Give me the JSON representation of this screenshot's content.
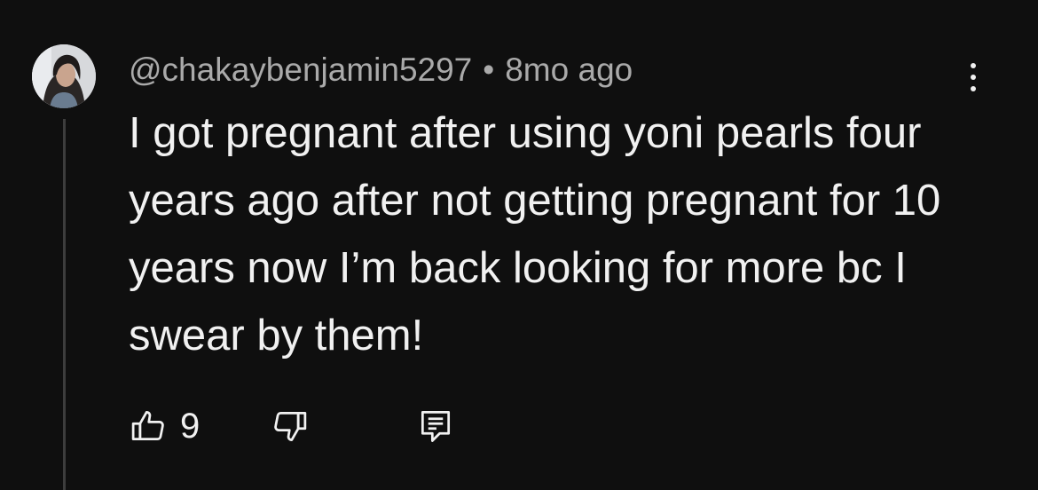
{
  "comment": {
    "username": "@chakaybenjamin5297",
    "separator": "•",
    "timestamp": "8mo ago",
    "text": "I got pregnant after using yoni pearls four years ago after not getting pregnant for 10 years now I’m back looking for more bc I swear by them!",
    "like_count": "9"
  },
  "icons": {
    "like": "thumb-up-icon",
    "dislike": "thumb-down-icon",
    "reply": "comment-reply-icon",
    "menu": "more-vertical-icon"
  },
  "colors": {
    "background": "#0f0f0f",
    "text_primary": "#f1f1f1",
    "text_secondary": "#aaaaaa",
    "thread_line": "#3d3d3d"
  }
}
